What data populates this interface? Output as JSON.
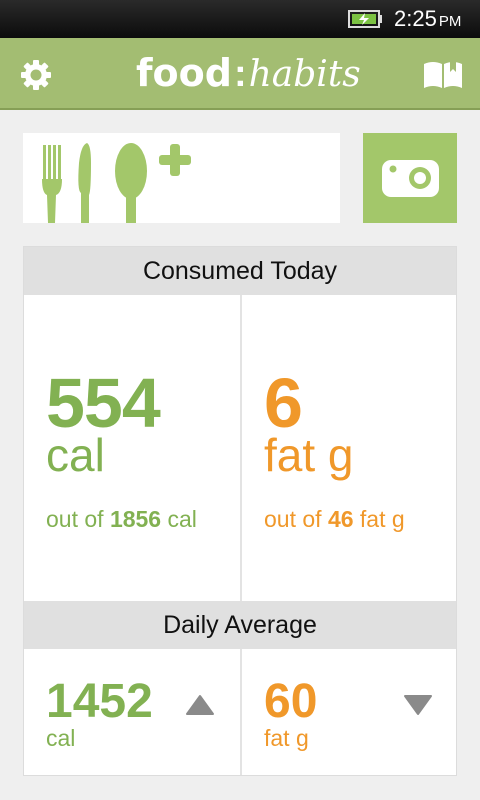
{
  "status_bar": {
    "time": "2:25",
    "ampm": "PM"
  },
  "header": {
    "brand_food": "food",
    "brand_colon": ":",
    "brand_habits": "habits"
  },
  "consumed_today": {
    "title": "Consumed Today",
    "calories": {
      "value": "554",
      "unit": "cal",
      "out_of_prefix": "out of",
      "goal": "1856",
      "goal_unit": "cal"
    },
    "fat": {
      "value": "6",
      "unit": "fat g",
      "out_of_prefix": "out of",
      "goal": "46",
      "goal_unit": "fat g"
    }
  },
  "daily_average": {
    "title": "Daily Average",
    "calories": {
      "value": "1452",
      "unit": "cal",
      "trend": "up"
    },
    "fat": {
      "value": "60",
      "unit": "fat g",
      "trend": "down"
    }
  },
  "colors": {
    "header": "#a3bd72",
    "accent_green": "#82b152",
    "accent_orange": "#f0982a"
  },
  "icons": [
    "battery-charging-icon",
    "gear-icon",
    "book-icon",
    "fork-icon",
    "knife-icon",
    "spoon-icon",
    "plus-icon",
    "camera-icon",
    "trend-up-icon",
    "trend-down-icon"
  ]
}
